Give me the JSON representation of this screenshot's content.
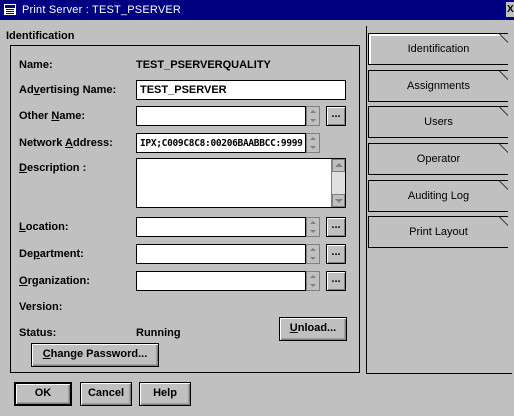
{
  "window": {
    "title": "Print Server : TEST_PSERVER",
    "close_label": "X"
  },
  "section": {
    "title": "Identification"
  },
  "form": {
    "name_label_prefix": "Name:",
    "name_value": "TEST_PSERVERQUALITY",
    "adv_label_a": "Ad",
    "adv_label_u": "v",
    "adv_label_b": "ertising Name:",
    "adv_value": "TEST_PSERVER",
    "other_label_a": "Other ",
    "other_label_u": "N",
    "other_label_b": "ame:",
    "other_value": "",
    "net_label_a": "Network ",
    "net_label_u": "A",
    "net_label_b": "ddress:",
    "net_value": "IPX;C009C8C8:00206BAABBCC:9999",
    "desc_label_u": "D",
    "desc_label_b": "escription :",
    "desc_value": "",
    "loc_label_u": "L",
    "loc_label_b": "ocation:",
    "loc_value": "",
    "dept_label_a": "De",
    "dept_label_u": "p",
    "dept_label_b": "artment:",
    "dept_value": "",
    "org_label_u": "O",
    "org_label_b": "rganization:",
    "org_value": "",
    "version_label": "Version:",
    "version_value": "",
    "status_label": "Status:",
    "status_value": "Running",
    "unload_u": "U",
    "unload_b": "nload...",
    "chpw_u": "C",
    "chpw_b": "hange Password...",
    "dots_label": "..."
  },
  "footer": {
    "ok": "OK",
    "cancel": "Cancel",
    "help": "Help"
  },
  "tabs": [
    {
      "label": "Identification"
    },
    {
      "label": "Assignments"
    },
    {
      "label": "Users"
    },
    {
      "label": "Operator"
    },
    {
      "label": "Auditing Log"
    },
    {
      "label": "Print Layout"
    }
  ]
}
